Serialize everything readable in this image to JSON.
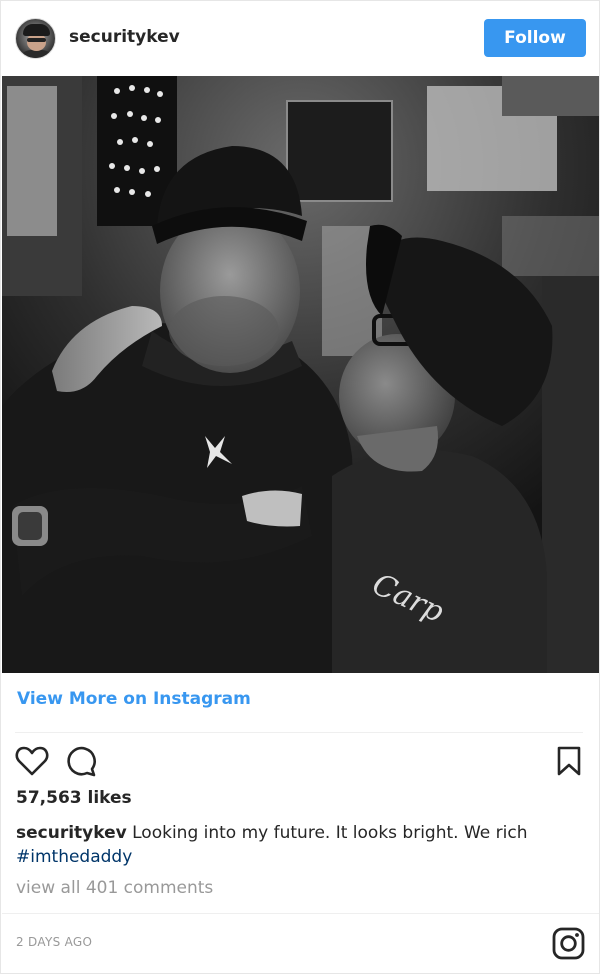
{
  "post": {
    "username": "securitykev",
    "follow_label": "Follow",
    "view_more_label": "View More on Instagram",
    "likes_text": "57,563 likes",
    "caption_user": "securitykev",
    "caption_text": " Looking into my future. It looks bright. We rich ",
    "caption_hashtag": "#imthedaddy",
    "view_comments_text": "view all 401 comments",
    "timestamp": "2 DAYS AGO"
  },
  "photo": {
    "sign_text": "Carp",
    "alt": "Black and white photo of two men in baseball caps"
  },
  "icons": {
    "avatar": "avatar",
    "like": "heart-icon",
    "comment": "comment-bubble-icon",
    "save": "bookmark-icon",
    "brand": "instagram-logo-icon"
  },
  "colors": {
    "accent": "#3897f0",
    "hashtag": "#003569",
    "muted": "#999999",
    "text": "#262626"
  }
}
